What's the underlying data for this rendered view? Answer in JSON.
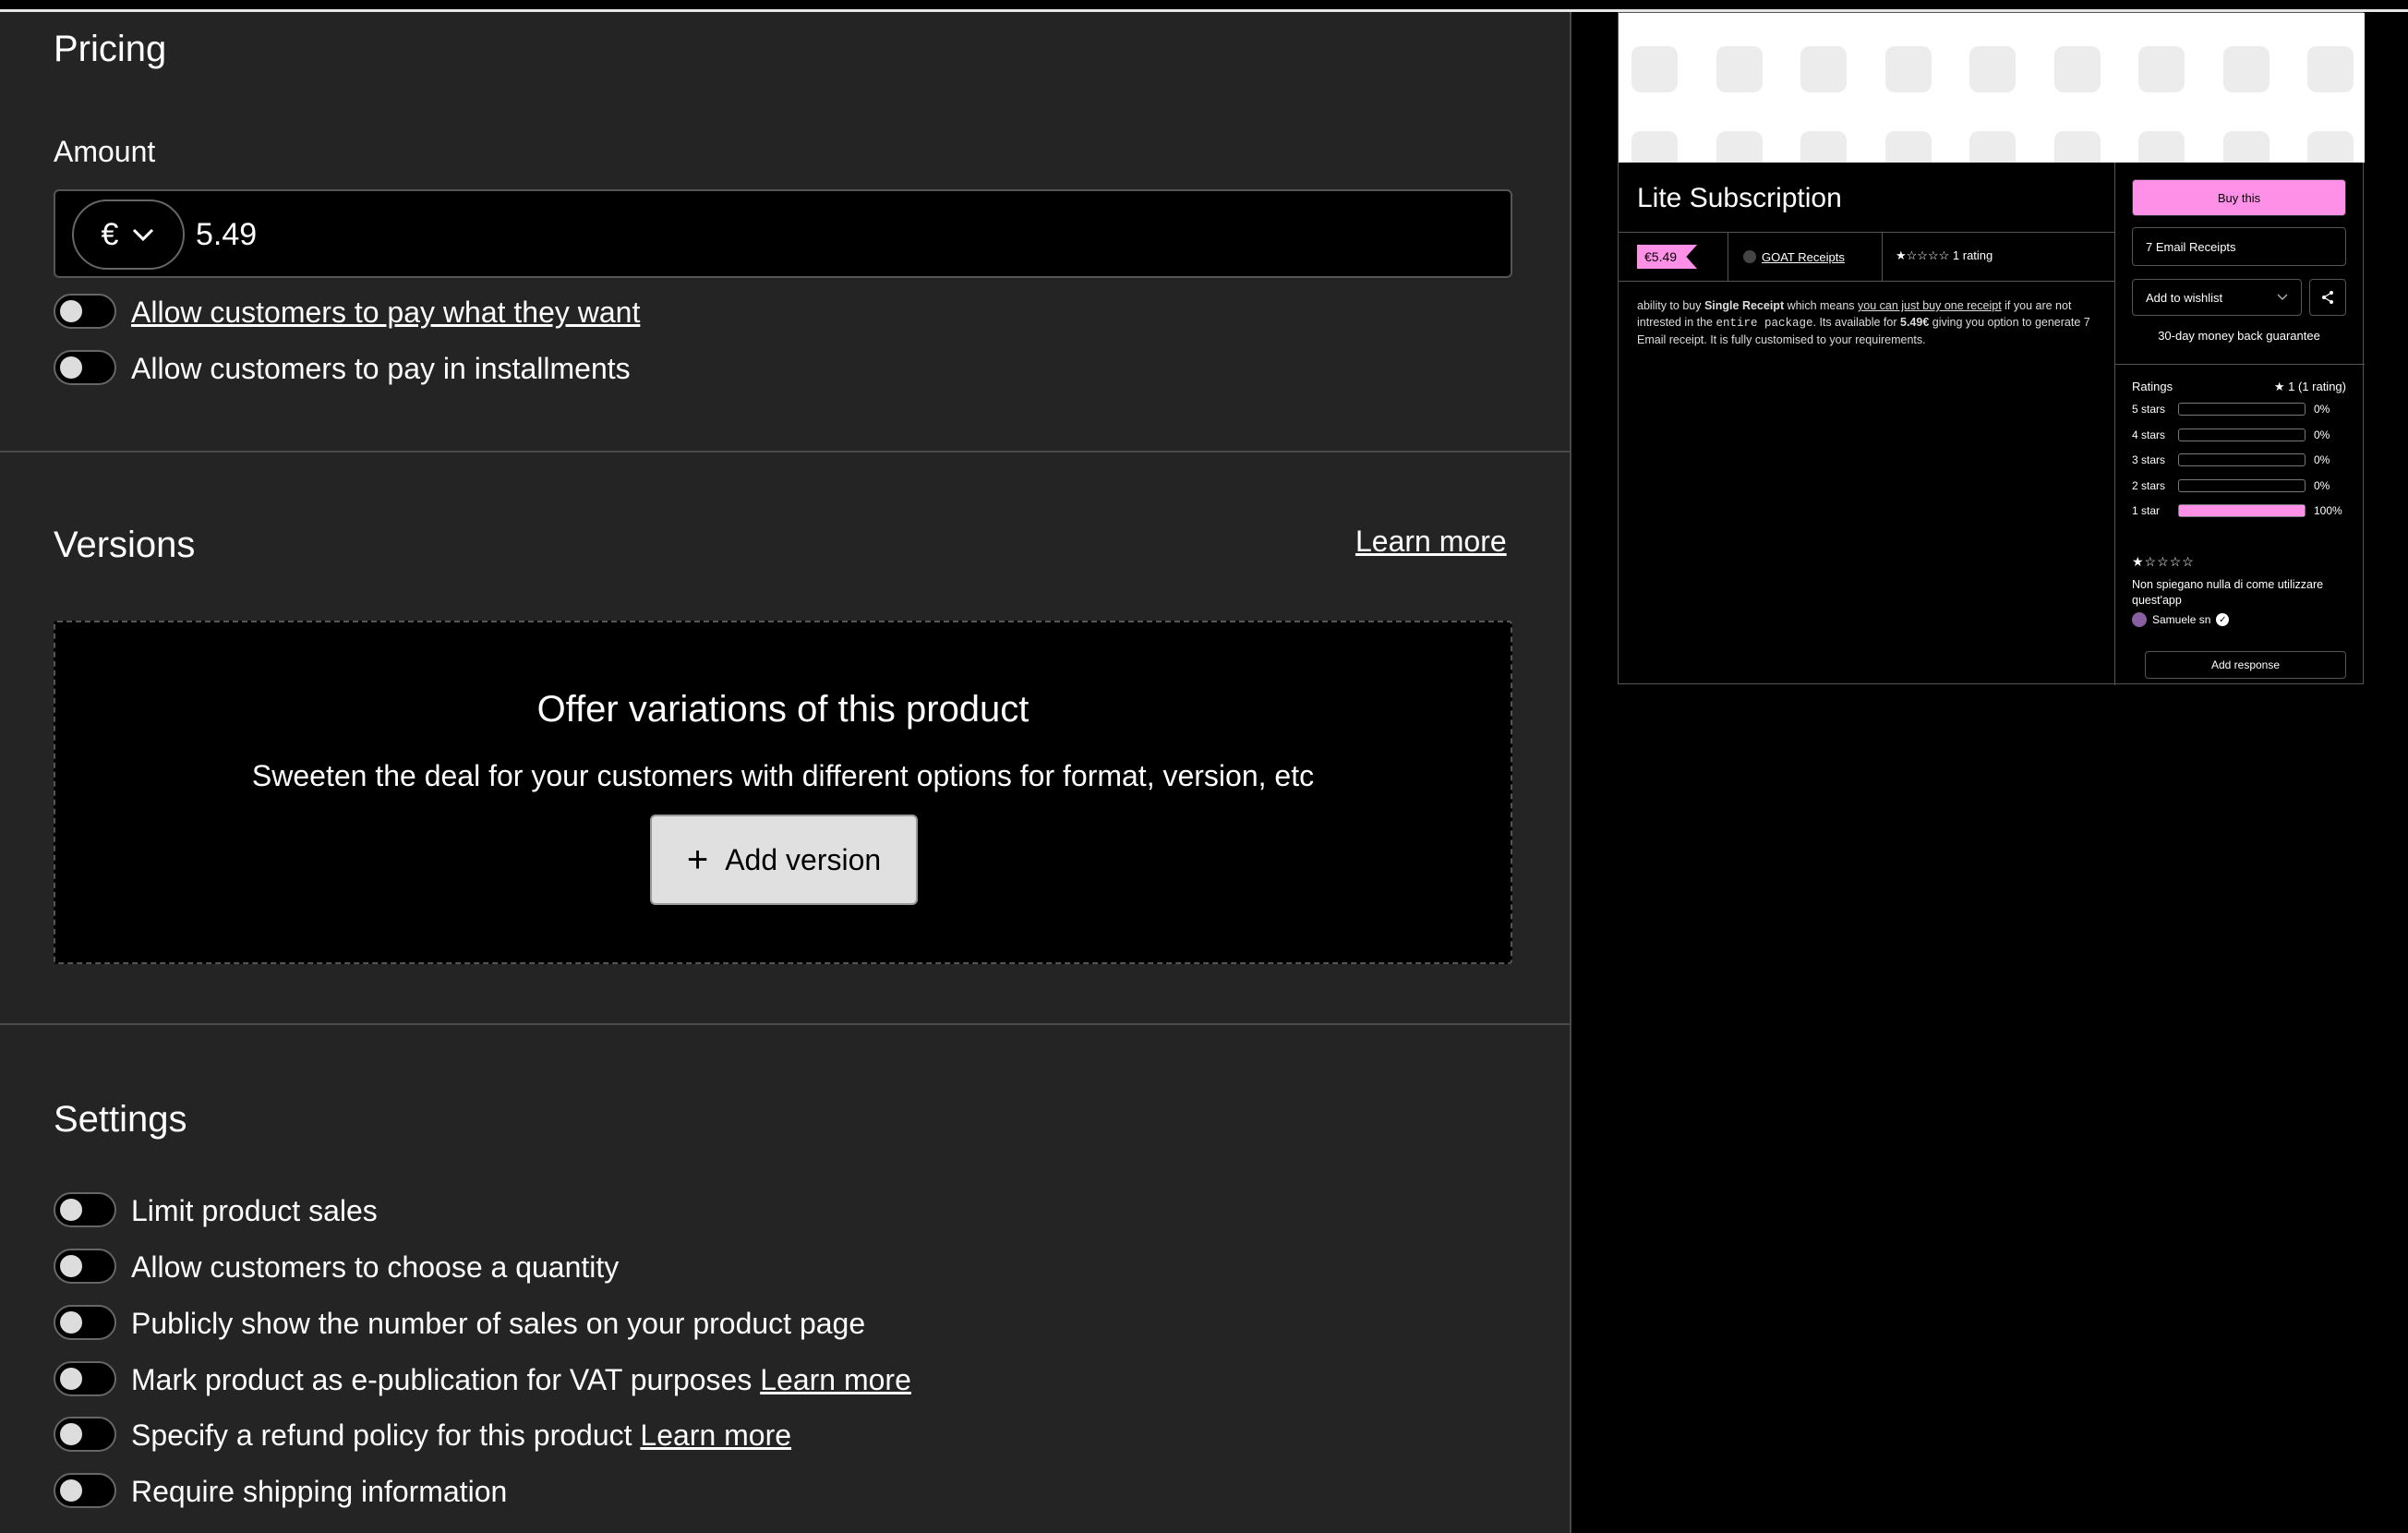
{
  "pricing": {
    "title": "Pricing",
    "amount_label": "Amount",
    "currency_symbol": "€",
    "amount_value": "5.49",
    "toggle_pwyw": "Allow customers to pay what they want",
    "toggle_installments": "Allow customers to pay in installments"
  },
  "versions": {
    "title": "Versions",
    "learn_more": "Learn more",
    "box_title": "Offer variations of this product",
    "box_subtitle": "Sweeten the deal for your customers with different options for format, version, etc",
    "add_button": "Add version",
    "add_icon": "+"
  },
  "settings": {
    "title": "Settings",
    "items": [
      {
        "label": "Limit product sales",
        "link": ""
      },
      {
        "label": "Allow customers to choose a quantity",
        "link": ""
      },
      {
        "label": "Publicly show the number of sales on your product page",
        "link": ""
      },
      {
        "label": "Mark product as e-publication for VAT purposes",
        "link": "Learn more"
      },
      {
        "label": "Specify a refund policy for this product",
        "link": "Learn more"
      },
      {
        "label": "Require shipping information",
        "link": ""
      }
    ]
  },
  "preview": {
    "title": "Lite Subscription",
    "price": "€5.49",
    "seller": "GOAT Receipts",
    "rating_stars": "★☆☆☆☆",
    "rating_count": "1 rating",
    "desc_1": "ability to buy ",
    "desc_bold_1": "Single Receipt",
    "desc_2": " which means ",
    "desc_link": "you can just buy one receipt",
    "desc_3": " if you are not intrested in the ",
    "desc_mono": "entire package",
    "desc_4": ". Its available for ",
    "desc_bold_2": "5.49€",
    "desc_5": " giving you option to generate 7 Email receipt. It is fully customised to your requirements.",
    "buy_button": "Buy this",
    "variant": "7 Email Receipts",
    "wishlist": "Add to wishlist",
    "guarantee": "30-day money back guarantee",
    "ratings_title": "Ratings",
    "ratings_summary": "★ 1 (1 rating)",
    "breakdown": [
      {
        "label": "5 stars",
        "percent": 0,
        "text": "0%"
      },
      {
        "label": "4 stars",
        "percent": 0,
        "text": "0%"
      },
      {
        "label": "3 stars",
        "percent": 0,
        "text": "0%"
      },
      {
        "label": "2 stars",
        "percent": 0,
        "text": "0%"
      },
      {
        "label": "1 star",
        "percent": 100,
        "text": "100%"
      }
    ],
    "review_stars": "★☆☆☆☆",
    "review_text": "Non spiegano nulla di come utilizzare quest'app",
    "reviewer": "Samuele sn",
    "add_response": "Add response",
    "accent_color": "#ff90e8"
  }
}
